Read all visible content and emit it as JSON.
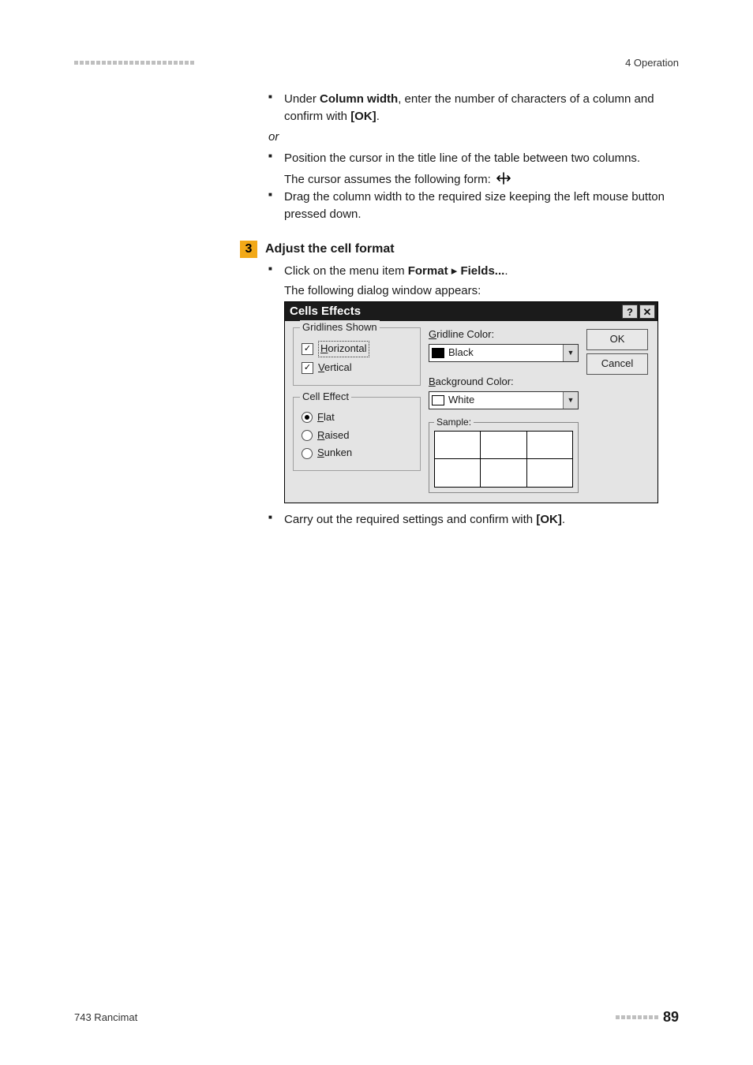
{
  "header": {
    "breadcrumb": "4 Operation"
  },
  "body": {
    "column_width_prefix": "Under ",
    "column_width_bold": "Column width",
    "column_width_suffix": ", enter the number of characters of a column and confirm with ",
    "column_width_ok": "[OK]",
    "column_width_period": ".",
    "or_text": "or",
    "position_cursor": "Position the cursor in the title line of the table between two columns.",
    "cursor_form": "The cursor assumes the following form:",
    "drag_column": "Drag the column width to the required size keeping the left mouse button pressed down."
  },
  "step": {
    "number": "3",
    "title": "Adjust the cell format",
    "click_prefix": "Click on the menu item ",
    "click_bold1": "Format",
    "click_sep": " ▸ ",
    "click_bold2": "Fields...",
    "click_suffix": ".",
    "following": "The following dialog window appears:"
  },
  "dialog": {
    "title": "Cells Effects",
    "help": "?",
    "close": "✕",
    "gridlines": {
      "legend": "Gridlines Shown",
      "horizontal_u": "H",
      "horizontal_rest": "orizontal",
      "vertical_u": "V",
      "vertical_rest": "ertical"
    },
    "celleffect": {
      "legend": "Cell Effect",
      "flat_u": "F",
      "flat_rest": "lat",
      "raised_u": "R",
      "raised_rest": "aised",
      "sunken_u": "S",
      "sunken_rest": "unken"
    },
    "gridline_color_label_u": "G",
    "gridline_color_label_rest": "ridline Color:",
    "gridline_color_value": "Black",
    "bg_color_label_u": "B",
    "bg_color_label_rest": "ackground Color:",
    "bg_color_value": "White",
    "sample_legend": "Sample:",
    "ok": "OK",
    "cancel": "Cancel"
  },
  "after": {
    "carry_prefix": "Carry out the required settings and confirm with ",
    "carry_bold": "[OK]",
    "carry_suffix": "."
  },
  "footer": {
    "product": "743 Rancimat",
    "page": "89"
  }
}
